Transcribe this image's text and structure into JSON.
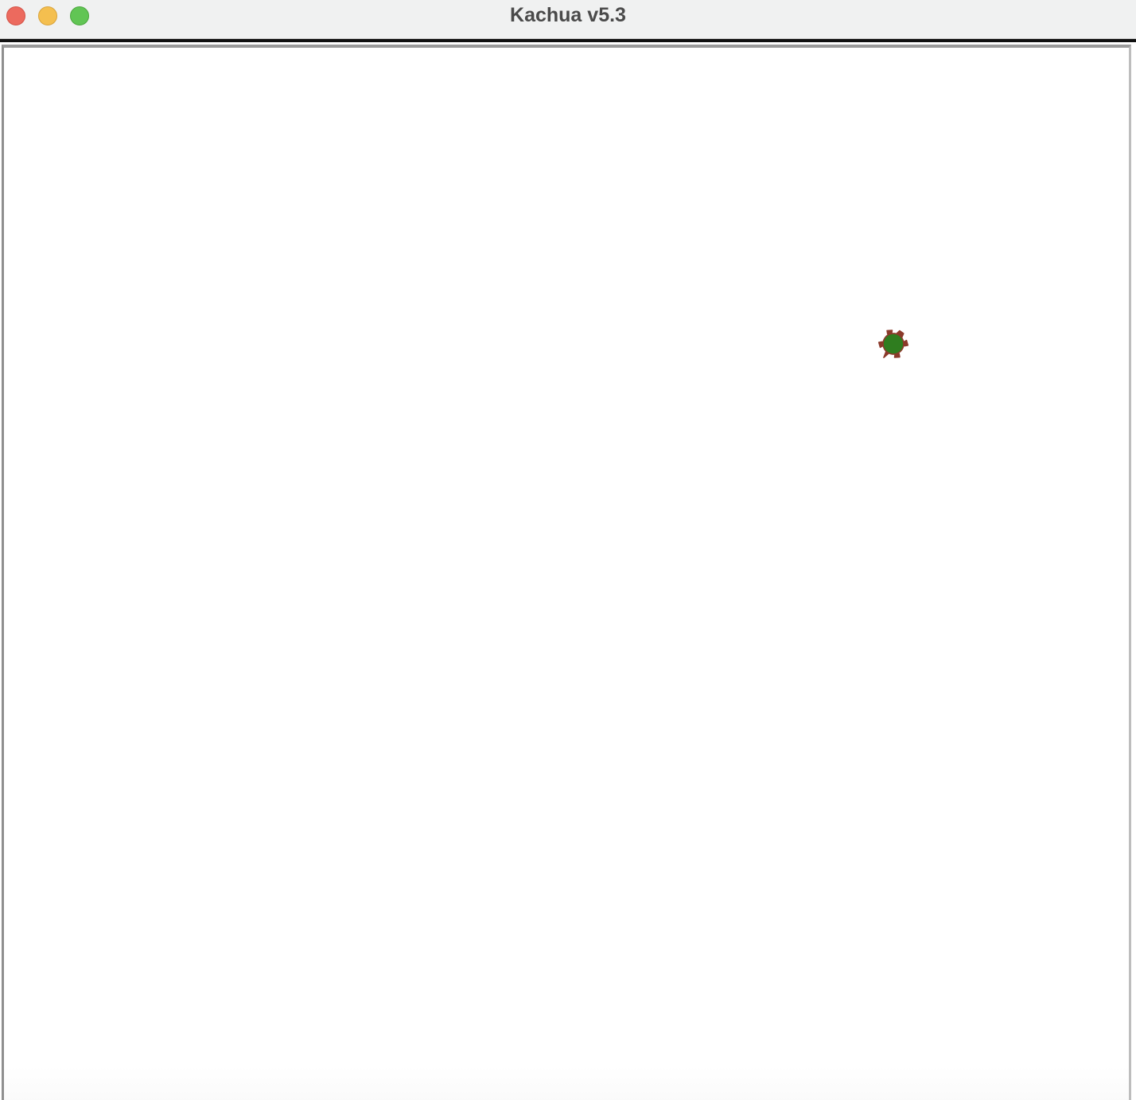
{
  "window": {
    "title": "Kachua v5.3"
  },
  "controls": {
    "close_icon": "close-icon",
    "minimize_icon": "minimize-icon",
    "maximize_icon": "maximize-icon"
  },
  "canvas": {
    "sprite": "turtle-icon",
    "colors": {
      "shell": "#2f7d1f",
      "outline": "#8b3a2b",
      "background": "#ffffff"
    }
  }
}
